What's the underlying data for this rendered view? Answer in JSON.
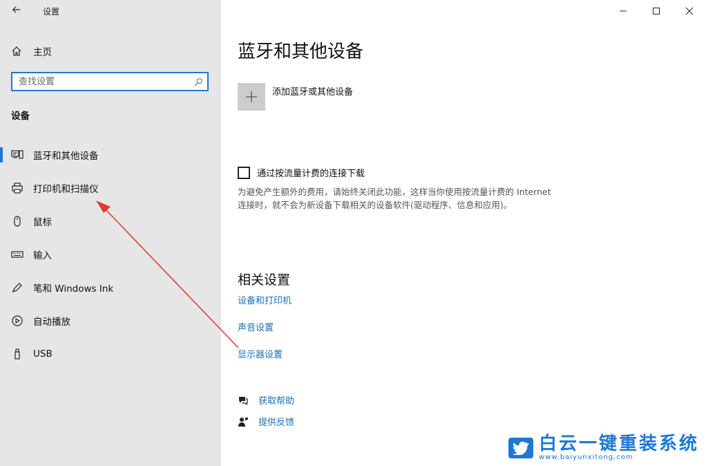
{
  "window": {
    "title": "设置"
  },
  "sidebar": {
    "home_label": "主页",
    "search_placeholder": "查找设置",
    "section_heading": "设备",
    "items": [
      {
        "label": "蓝牙和其他设备",
        "icon": "bluetooth-devices-icon",
        "active": true
      },
      {
        "label": "打印机和扫描仪",
        "icon": "printer-icon",
        "active": false
      },
      {
        "label": "鼠标",
        "icon": "mouse-icon",
        "active": false
      },
      {
        "label": "输入",
        "icon": "keyboard-icon",
        "active": false
      },
      {
        "label": "笔和 Windows Ink",
        "icon": "pen-icon",
        "active": false
      },
      {
        "label": "自动播放",
        "icon": "autoplay-icon",
        "active": false
      },
      {
        "label": "USB",
        "icon": "usb-icon",
        "active": false
      }
    ]
  },
  "main": {
    "title": "蓝牙和其他设备",
    "add_device_label": "添加蓝牙或其他设备",
    "metered": {
      "label": "通过按流量计费的连接下载",
      "checked": false,
      "description": "为避免产生额外的费用，请始终关闭此功能，这样当你使用按流量计费的 Internet 连接时，就不会为新设备下载相关的设备软件(驱动程序、信息和应用)。"
    },
    "related_heading": "相关设置",
    "related_links": [
      "设备和打印机",
      "声音设置",
      "显示器设置"
    ],
    "help_links": [
      {
        "label": "获取帮助",
        "icon": "help-chat-icon"
      },
      {
        "label": "提供反馈",
        "icon": "feedback-icon"
      }
    ]
  },
  "watermark": {
    "title": "白云一键重装系统",
    "url": "www.baiyunxitong.com"
  },
  "colors": {
    "accent": "#1e78d2",
    "link": "#1a6fb8",
    "sidebar_bg": "#e6e6e6",
    "annotation_arrow": "#e53935"
  }
}
